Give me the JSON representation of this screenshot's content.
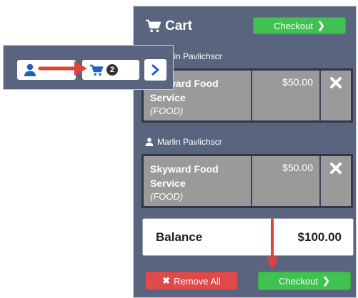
{
  "cart": {
    "title": "Cart",
    "checkout_label": "Checkout",
    "students": [
      {
        "name": "Marlin Pavlichscr",
        "items": [
          {
            "name_line1": "Skyward Food",
            "name_line2": "Service",
            "type": "(FOOD)",
            "price": "$50.00"
          }
        ]
      },
      {
        "name": "Marlin Pavlichscr",
        "items": [
          {
            "name_line1": "Skyward Food",
            "name_line2": "Service",
            "type": "(FOOD)",
            "price": "$50.00"
          }
        ]
      }
    ],
    "balance_label": "Balance",
    "balance_value": "$100.00",
    "remove_all_label": "Remove All",
    "checkout_bottom_label": "Checkout"
  },
  "header_bar": {
    "cart_count": "2"
  },
  "icons": {
    "cart": "cart-icon",
    "user": "user-icon",
    "remove": "close-icon",
    "next": "chevron-right-icon",
    "annotation": "red-arrow"
  },
  "colors": {
    "panel": "#59657e",
    "green": "#3fc24f",
    "red": "#e04a4a",
    "icon_blue": "#1f5fbf",
    "arrow_red": "#e0423a"
  }
}
